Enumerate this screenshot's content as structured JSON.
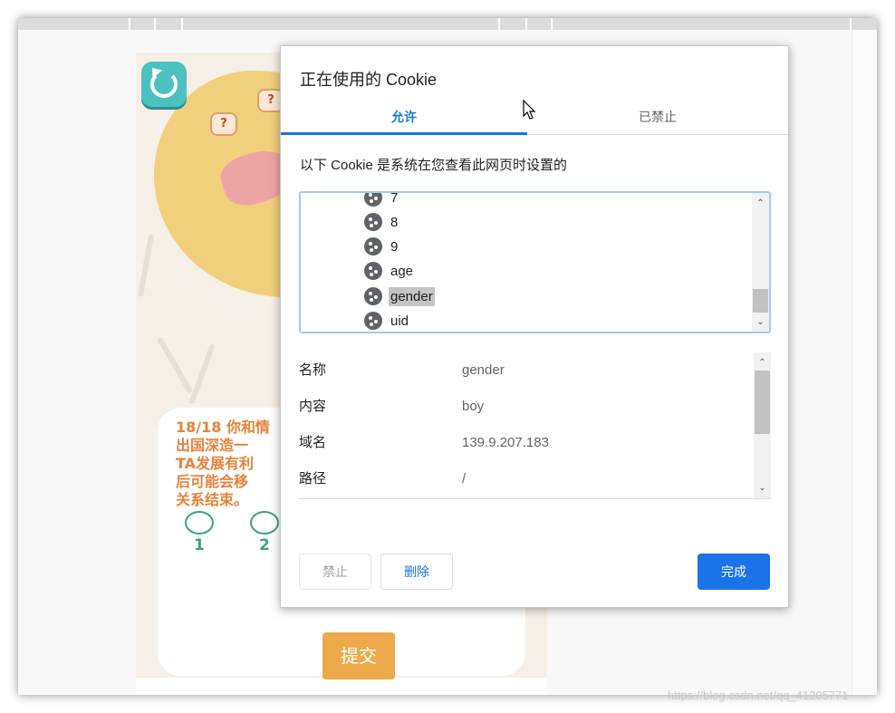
{
  "dialog": {
    "title": "正在使用的 Cookie",
    "tabs": [
      {
        "label": "允许",
        "active": true
      },
      {
        "label": "已禁止",
        "active": false
      }
    ],
    "description": "以下 Cookie 是系统在您查看此网页时设置的",
    "cookies": [
      {
        "name": "7",
        "selected": false
      },
      {
        "name": "8",
        "selected": false
      },
      {
        "name": "9",
        "selected": false
      },
      {
        "name": "age",
        "selected": false
      },
      {
        "name": "gender",
        "selected": true
      },
      {
        "name": "uid",
        "selected": false
      }
    ],
    "details": [
      {
        "key": "名称",
        "value": "gender"
      },
      {
        "key": "内容",
        "value": "boy"
      },
      {
        "key": "域名",
        "value": "139.9.207.183"
      },
      {
        "key": "路径",
        "value": "/"
      }
    ],
    "buttons": {
      "block": "禁止",
      "delete": "删除",
      "done": "完成"
    }
  },
  "background_page": {
    "question_text": "18/18 你和情侣... 出国深造一... TA发展有利... 后可能会移... 关系结束。",
    "question_lines": [
      "18/18 你和情",
      "出国深造一",
      "TA发展有利",
      "后可能会移",
      "关系结束。"
    ],
    "options": [
      "1",
      "2"
    ],
    "submit_label": "提交",
    "bubble_mark": "?"
  },
  "watermark": "https://blog.csdn.net/qq_41205771",
  "colors": {
    "accent": "#1a73e8",
    "selected_bg": "#c4c4c4",
    "submit": "#eda94a",
    "option_green": "#3aa56f",
    "question_orange": "#e8823a"
  },
  "icons": [
    "refresh-icon",
    "cookie-icon",
    "chevron-up-icon",
    "chevron-down-icon",
    "mouse-cursor-icon"
  ]
}
